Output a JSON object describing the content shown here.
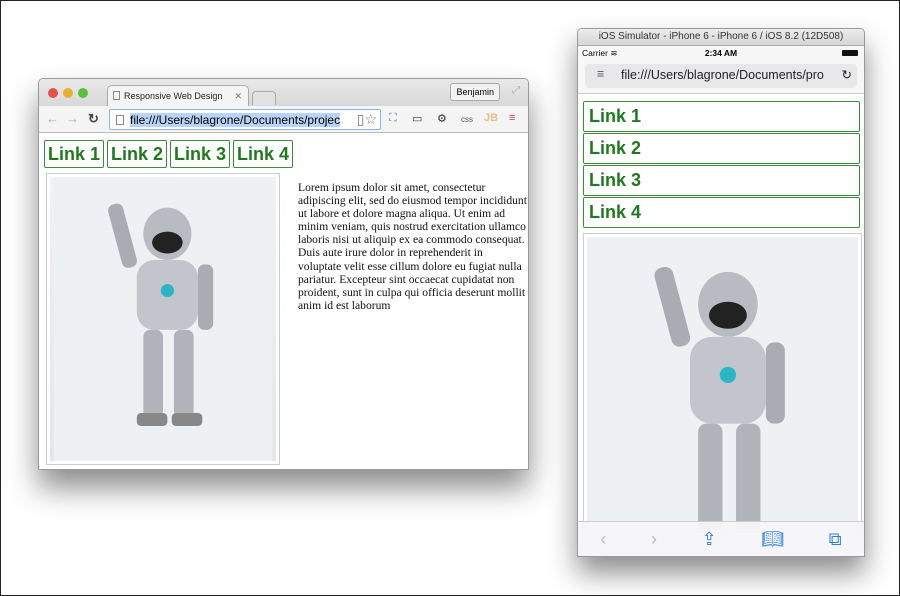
{
  "chrome": {
    "tab_title": "Responsive Web Design",
    "profile": "Benjamin",
    "url": "file:///Users/blagrone/Documents/projec",
    "toolbar_css": "css",
    "toolbar_jb": "JB",
    "links": [
      "Link 1",
      "Link 2",
      "Link 3",
      "Link 4"
    ],
    "paragraph": "Lorem ipsum dolor sit amet, consectetur adipiscing elit, sed do eiusmod tempor incididunt ut labore et dolore magna aliqua. Ut enim ad minim veniam, quis nostrud exercitation ullamco laboris nisi ut aliquip ex ea commodo consequat. Duis aute irure dolor in reprehenderit in voluptate velit esse cillum dolore eu fugiat nulla pariatur. Excepteur sint occaecat cupidatat non proident, sunt in culpa qui officia deserunt mollit anim id est laborum"
  },
  "ios": {
    "window_title": "iOS Simulator - iPhone 6 - iPhone 6 / iOS 8.2 (12D508)",
    "carrier": "Carrier",
    "time": "2:34 AM",
    "url": "file:///Users/blagrone/Documents/pro",
    "links": [
      "Link 1",
      "Link 2",
      "Link 3",
      "Link 4"
    ]
  },
  "colors": {
    "link_green": "#1f7a1f",
    "ios_blue": "#2a7ee0"
  }
}
